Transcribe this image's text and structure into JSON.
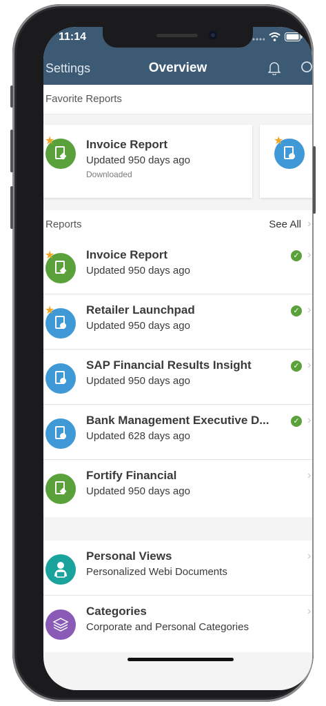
{
  "status_bar": {
    "time": "11:14"
  },
  "nav": {
    "left_label": "Settings",
    "title": "Overview"
  },
  "favorites": {
    "header": "Favorite Reports",
    "cards": [
      {
        "title": "Invoice Report",
        "subtitle": "Updated 950 days ago",
        "status": "Downloaded",
        "icon_color": "#5ba13b",
        "starred": true
      },
      {
        "title": "",
        "subtitle": "",
        "status": "",
        "icon_color": "#3f99d6",
        "starred": true
      }
    ]
  },
  "reports": {
    "header": "Reports",
    "see_all": "See All",
    "items": [
      {
        "title": "Invoice Report",
        "subtitle": "Updated 950 days ago",
        "starred": true,
        "downloaded": true,
        "icon_color": "#5ba13b"
      },
      {
        "title": "Retailer Launchpad",
        "subtitle": "Updated 950 days ago",
        "starred": true,
        "downloaded": true,
        "icon_color": "#3f99d6"
      },
      {
        "title": "SAP Financial Results Insight",
        "subtitle": "Updated 950 days ago",
        "starred": false,
        "downloaded": true,
        "icon_color": "#3f99d6"
      },
      {
        "title": "Bank Management Executive D...",
        "subtitle": "Updated 628 days ago",
        "starred": false,
        "downloaded": true,
        "icon_color": "#3f99d6"
      },
      {
        "title": "Fortify Financial",
        "subtitle": "Updated 950 days ago",
        "starred": false,
        "downloaded": false,
        "icon_color": "#5ba13b"
      }
    ]
  },
  "more": {
    "items": [
      {
        "title": "Personal Views",
        "subtitle": "Personalized Webi Documents",
        "icon_color": "#1aa29c"
      },
      {
        "title": "Categories",
        "subtitle": "Corporate and Personal Categories",
        "icon_color": "#8a5bb6"
      }
    ]
  },
  "colors": {
    "nav_bar": "#3c5a74",
    "check": "#5ba13b",
    "star": "#f1a523"
  }
}
